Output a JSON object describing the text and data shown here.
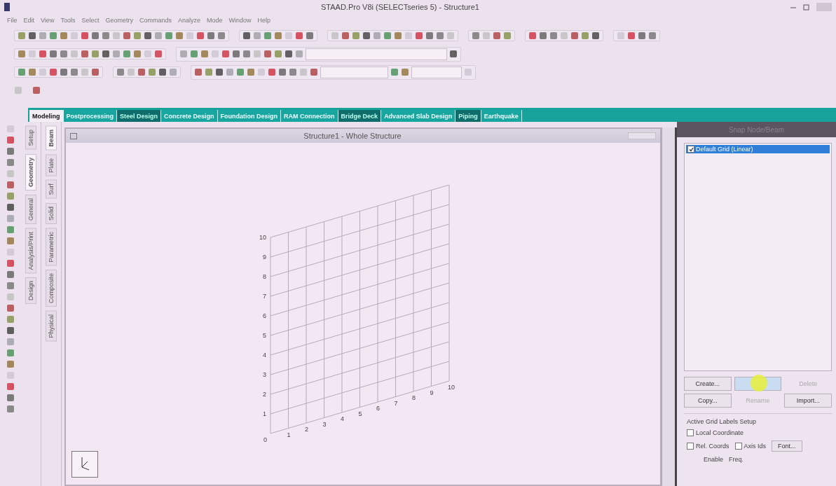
{
  "window": {
    "title": "STAAD.Pro V8i (SELECTseries 5) - Structure1"
  },
  "menu": [
    "File",
    "Edit",
    "View",
    "Tools",
    "Select",
    "Geometry",
    "Commands",
    "Analyze",
    "Mode",
    "Window",
    "Help"
  ],
  "tabs": [
    {
      "label": "Modeling",
      "selected": true,
      "shaded": false
    },
    {
      "label": "Postprocessing",
      "selected": false,
      "shaded": false
    },
    {
      "label": "Steel Design",
      "selected": false,
      "shaded": true
    },
    {
      "label": "Concrete Design",
      "selected": false,
      "shaded": false
    },
    {
      "label": "Foundation Design",
      "selected": false,
      "shaded": false
    },
    {
      "label": "RAM Connection",
      "selected": false,
      "shaded": false
    },
    {
      "label": "Bridge Deck",
      "selected": false,
      "shaded": true
    },
    {
      "label": "Advanced Slab Design",
      "selected": false,
      "shaded": false
    },
    {
      "label": "Piping",
      "selected": false,
      "shaded": true
    },
    {
      "label": "Earthquake",
      "selected": false,
      "shaded": false
    }
  ],
  "side_tabs_outer": [
    {
      "label": "Setup",
      "selected": false
    },
    {
      "label": "Geometry",
      "selected": true
    },
    {
      "label": "General",
      "selected": false
    },
    {
      "label": "Analysis/Print",
      "selected": false
    },
    {
      "label": "Design",
      "selected": false
    }
  ],
  "side_tabs_inner": [
    {
      "label": "Beam",
      "selected": true
    },
    {
      "label": "Plate",
      "selected": false
    },
    {
      "label": "Surf",
      "selected": false
    },
    {
      "label": "Solid",
      "selected": false
    },
    {
      "label": "Parametric",
      "selected": false
    },
    {
      "label": "Composite",
      "selected": false
    },
    {
      "label": "Physical",
      "selected": false
    }
  ],
  "viewport": {
    "title": "Structure1 - Whole Structure",
    "grid": {
      "origin_label": "0",
      "y_labels": [
        "10",
        "9",
        "8",
        "7",
        "6",
        "5",
        "4",
        "3",
        "2",
        "1"
      ],
      "x_labels": [
        "1",
        "2",
        "3",
        "4",
        "5",
        "6",
        "7",
        "8",
        "9",
        "10"
      ]
    }
  },
  "dialog": {
    "title": "Snap Node/Beam",
    "list": [
      {
        "label": "Default Grid (Linear)",
        "checked": true,
        "selected": true
      }
    ],
    "buttons": [
      {
        "label": "Create...",
        "disabled": false,
        "hovered": false
      },
      {
        "disabled": false,
        "hovered": true
      },
      {
        "label": "Delete",
        "disabled": true,
        "hovered": false
      },
      {
        "label": "Copy...",
        "disabled": false,
        "hovered": false
      },
      {
        "label": "Rename",
        "disabled": true,
        "hovered": false
      },
      {
        "label": "Import...",
        "disabled": false,
        "hovered": false
      }
    ],
    "labels_setup": {
      "title": "Active Grid Labels Setup",
      "local_coordinate": {
        "label": "Local Coordinate",
        "checked": false
      },
      "options": [
        {
          "label": "Rel. Coords",
          "checked": false
        },
        {
          "label": "Axis Ids",
          "checked": false
        }
      ],
      "font_button": "Font...",
      "footer": [
        "Enable",
        "Freq."
      ]
    }
  }
}
